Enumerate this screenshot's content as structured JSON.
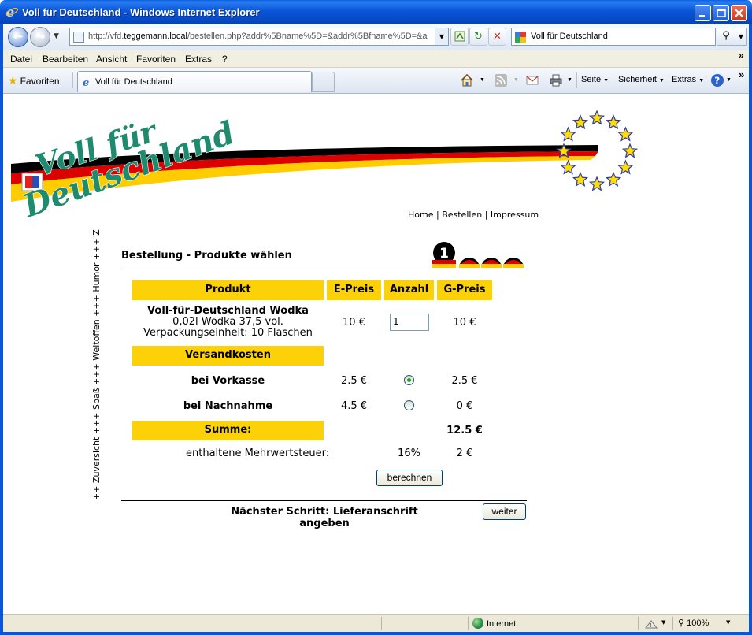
{
  "window": {
    "title": "Voll für Deutschland - Windows Internet Explorer"
  },
  "address": {
    "url_prefix": "http://vfd.",
    "url_host": "teggemann.local",
    "url_rest": "/bestellen.php?addr%5Bname%5D=&addr%5Bfname%5D=&a"
  },
  "search": {
    "value": "Voll für Deutschland"
  },
  "menu": [
    "Datei",
    "Bearbeiten",
    "Ansicht",
    "Favoriten",
    "Extras",
    "?"
  ],
  "favorites_bar": {
    "favorites_label": "Favoriten",
    "tab_label": "Voll für Deutschland",
    "tools": [
      "Seite",
      "Sicherheit",
      "Extras"
    ]
  },
  "status": {
    "zone": "Internet",
    "zoom": "100%"
  },
  "banner": {
    "logo_text": "Voll für Deutschland"
  },
  "sidebar_ticker": "++ Zuversicht +++ Spaß +++ Weltoffen +++ Humor +++ Z",
  "nav": {
    "home": "Home",
    "sep1": "|",
    "order": "Bestellen",
    "sep2": "|",
    "imprint": "Impressum"
  },
  "page": {
    "title": "Bestellung - Produkte wählen",
    "step_number": "1"
  },
  "table": {
    "headers": [
      "Produkt",
      "E-Preis",
      "Anzahl",
      "G-Preis"
    ],
    "product": {
      "name": "Voll-für-Deutschland Wodka",
      "desc": "0,02l Wodka 37,5 vol.",
      "unit": "Verpackungseinheit: 10 Flaschen",
      "unit_price": "10 €",
      "quantity": "1",
      "total": "10 €"
    },
    "shipping_header": "Versandkosten",
    "shipping": [
      {
        "label": "bei Vorkasse",
        "price": "2.5 €",
        "selected": true,
        "total": "2.5 €"
      },
      {
        "label": "bei Nachnahme",
        "price": "4.5 €",
        "selected": false,
        "total": "0 €"
      }
    ],
    "sum_label": "Summe:",
    "sum_value": "12.5 €",
    "vat_label": "enthaltene Mehrwertsteuer:",
    "vat_rate": "16%",
    "vat_value": "2 €"
  },
  "buttons": {
    "calculate": "berechnen",
    "next": "weiter"
  },
  "next_step": "Nächster Schritt: Lieferanschrift angeben",
  "colors": {
    "accent_yellow": "#fcd108",
    "logo_green": "#1e8a6e",
    "flag_black": "#000000",
    "flag_red": "#dd0000",
    "flag_gold": "#ffcc00",
    "eu_blue": "#2b3aa8"
  }
}
